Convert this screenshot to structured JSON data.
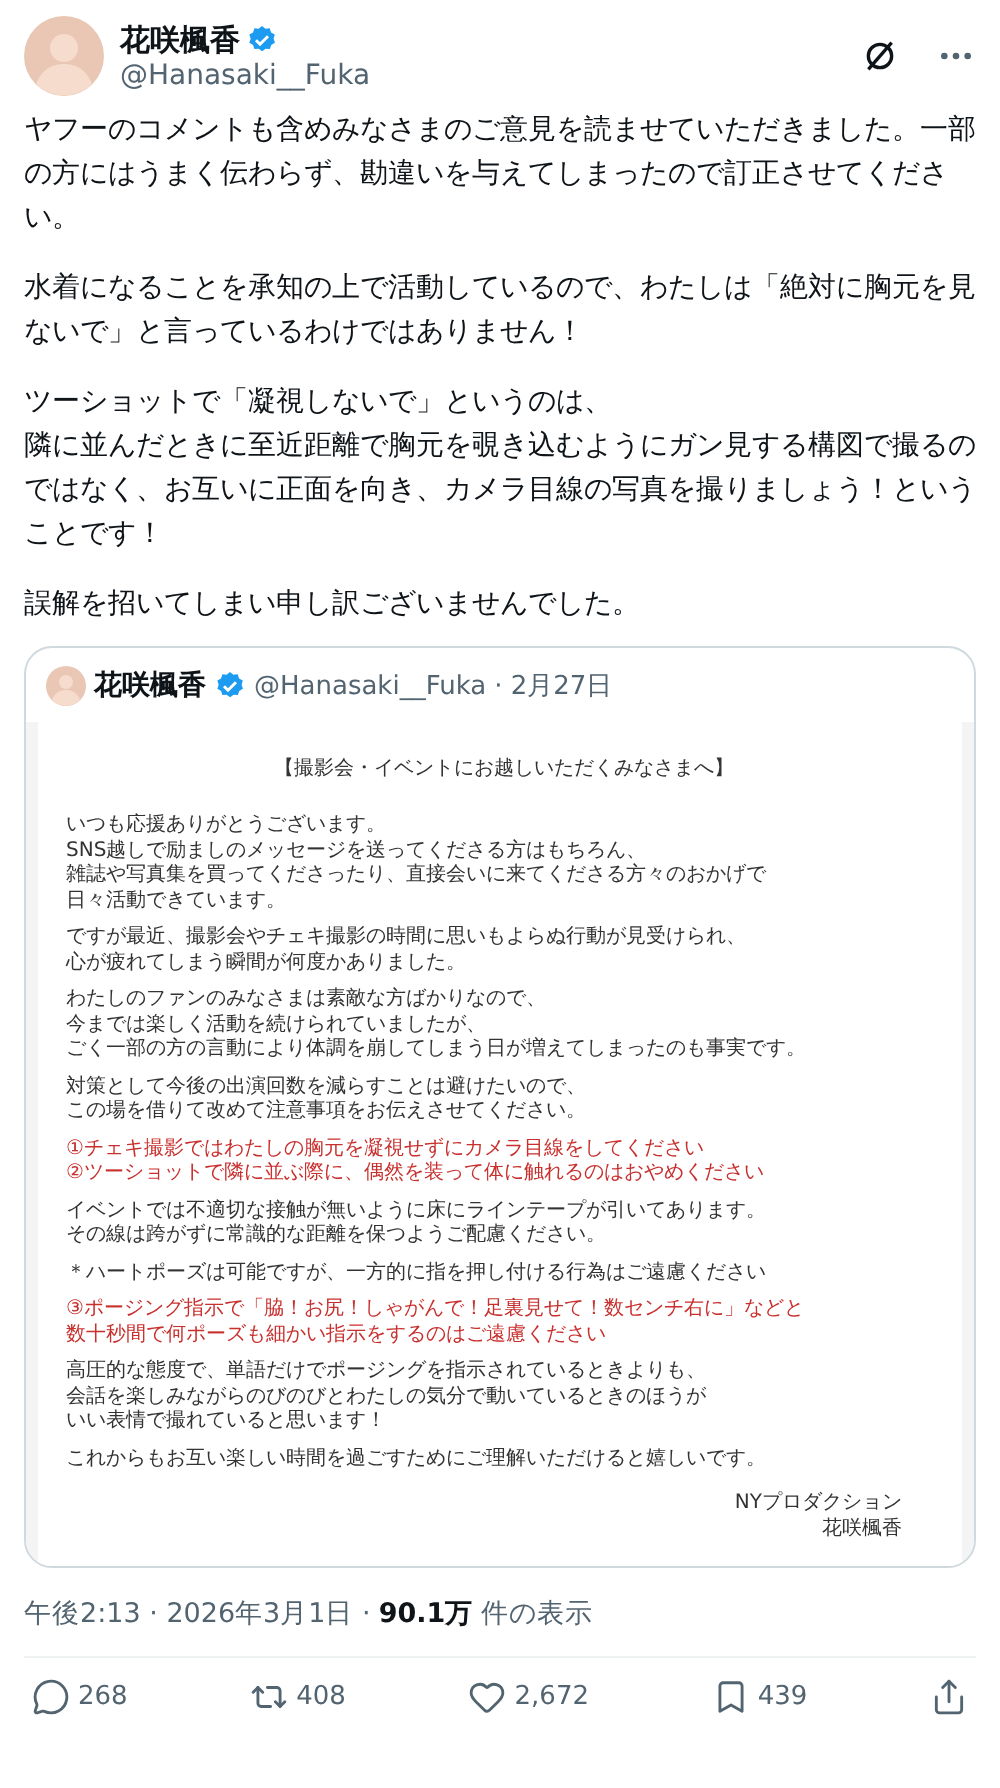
{
  "author": {
    "name": "花咲楓香",
    "handle": "@Hanasaki__Fuka",
    "verified": true
  },
  "body": [
    {
      "lines": [
        "ヤフーのコメントも含めみなさまのご意見を読ませていただきました。一部の方にはうまく伝わらず、勘違いを与えてしまったので訂正させてください。"
      ]
    },
    {
      "lines": [
        "水着になることを承知の上で活動しているので、わたしは「絶対に胸元を見ないで」と言っているわけではありません！"
      ]
    },
    {
      "lines": [
        "ツーショットで「凝視しないで」というのは、",
        "隣に並んだときに至近距離で胸元を覗き込むようにガン見する構図で撮るのではなく、お互いに正面を向き、カメラ目線の写真を撮りましょう！ということです！"
      ]
    },
    {
      "lines": [
        "誤解を招いてしまい申し訳ございませんでした。"
      ]
    }
  ],
  "quote": {
    "name": "花咲楓香",
    "verified": true,
    "handle": "@Hanasaki__Fuka",
    "date": "· 2月27日",
    "notice": {
      "title": "【撮影会・イベントにお越しいただくみなさまへ】",
      "blocks": [
        {
          "kind": "normal",
          "lines": [
            "いつも応援ありがとうございます。",
            "SNS越しで励ましのメッセージを送ってくださる方はもちろん、",
            "雑誌や写真集を買ってくださったり、直接会いに来てくださる方々のおかげで",
            "日々活動できています。"
          ]
        },
        {
          "kind": "normal",
          "lines": [
            "ですが最近、撮影会やチェキ撮影の時間に思いもよらぬ行動が見受けられ、",
            "心が疲れてしまう瞬間が何度かありました。"
          ]
        },
        {
          "kind": "normal",
          "lines": [
            "わたしのファンのみなさまは素敵な方ばかりなので、",
            "今までは楽しく活動を続けられていましたが、",
            "ごく一部の方の言動により体調を崩してしまう日が増えてしまったのも事実です。"
          ]
        },
        {
          "kind": "normal",
          "lines": [
            "対策として今後の出演回数を減らすことは避けたいので、",
            "この場を借りて改めて注意事項をお伝えさせてください。"
          ]
        },
        {
          "kind": "alert",
          "lines": [
            "①チェキ撮影ではわたしの胸元を凝視せずにカメラ目線をしてください",
            "②ツーショットで隣に並ぶ際に、偶然を装って体に触れるのはおやめください"
          ]
        },
        {
          "kind": "normal",
          "lines": [
            "イベントでは不適切な接触が無いように床にラインテープが引いてあります。",
            "その線は跨がずに常識的な距離を保つようご配慮ください。"
          ]
        },
        {
          "kind": "normal",
          "lines": [
            "＊ハートポーズは可能ですが、一方的に指を押し付ける行為はご遠慮ください"
          ]
        },
        {
          "kind": "alert",
          "lines": [
            "③ポージング指示で「脇！お尻！しゃがんで！足裏見せて！数センチ右に」などと",
            "数十秒間で何ポーズも細かい指示をするのはご遠慮ください"
          ]
        },
        {
          "kind": "normal",
          "lines": [
            "高圧的な態度で、単語だけでポージングを指示されているときよりも、",
            "会話を楽しみながらのびのびとわたしの気分で動いているときのほうが",
            "いい表情で撮れていると思います！"
          ]
        },
        {
          "kind": "normal",
          "lines": [
            "これからもお互い楽しい時間を過ごすためにご理解いただけると嬉しいです。"
          ]
        }
      ],
      "signature": [
        "NYプロダクション",
        "花咲楓香"
      ]
    }
  },
  "meta": {
    "time": "午後2:13 · 2026年3月1日 ·",
    "views": "90.1万",
    "views_label": "件の表示"
  },
  "actions": [
    {
      "kind": "reply",
      "count": "268"
    },
    {
      "kind": "repost",
      "count": "408"
    },
    {
      "kind": "like",
      "count": "2,672"
    },
    {
      "kind": "bookmark",
      "count": "439"
    },
    {
      "kind": "share"
    }
  ]
}
